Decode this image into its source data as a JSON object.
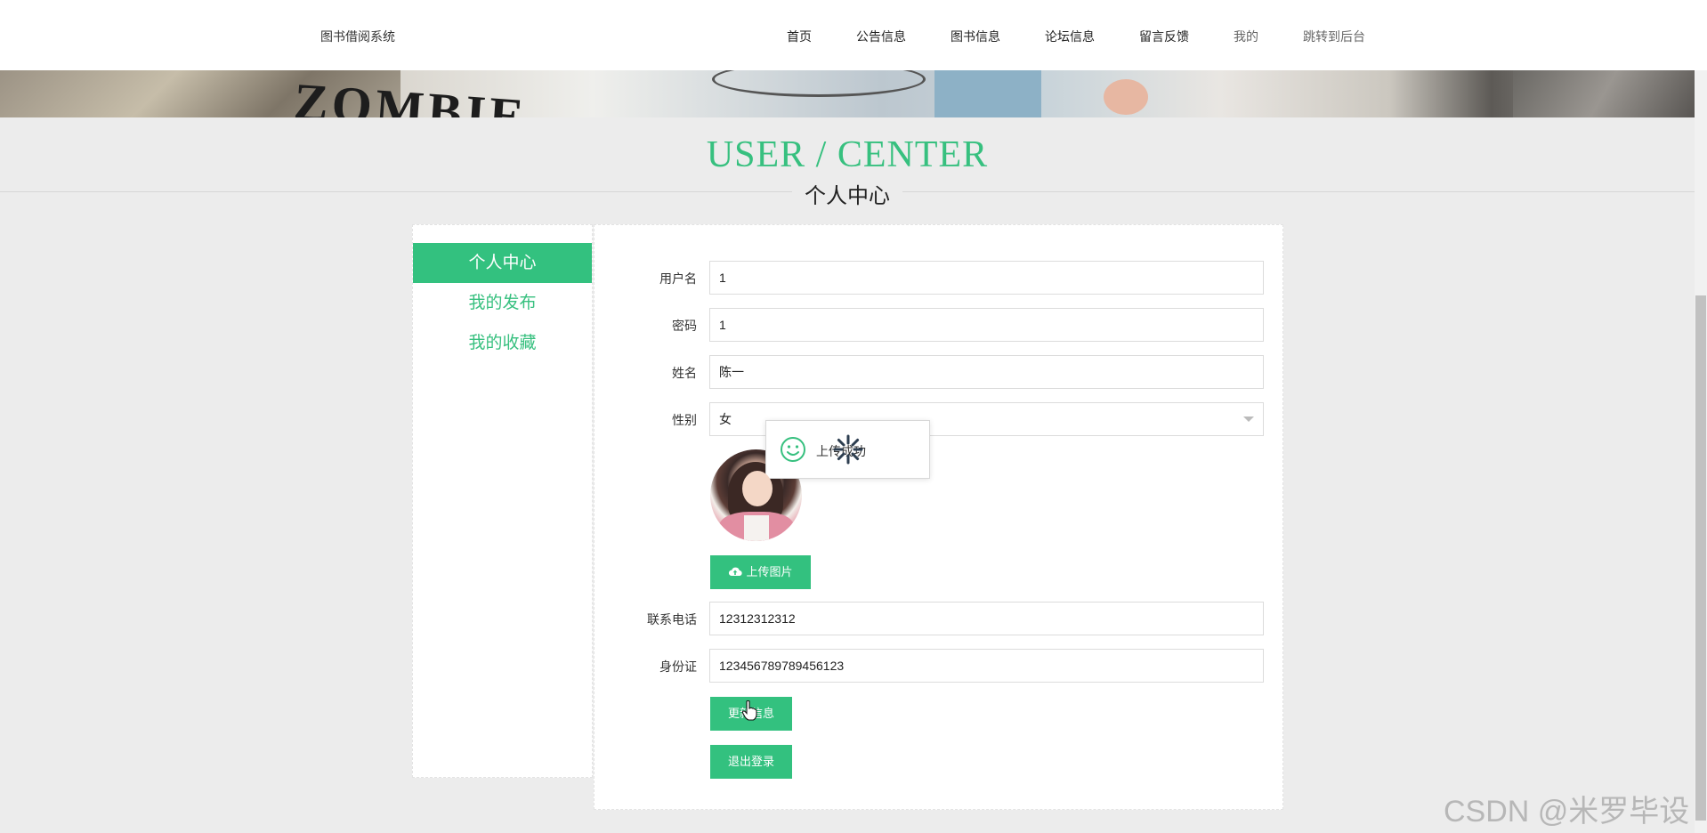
{
  "header": {
    "brand": "图书借阅系统",
    "nav": [
      "首页",
      "公告信息",
      "图书信息",
      "论坛信息",
      "留言反馈",
      "我的",
      "跳转到后台"
    ]
  },
  "section": {
    "title_en": "USER / CENTER",
    "title_cn": "个人中心"
  },
  "sidebar": {
    "items": [
      "个人中心",
      "我的发布",
      "我的收藏"
    ]
  },
  "form": {
    "username": {
      "label": "用户名",
      "value": "1"
    },
    "password": {
      "label": "密码",
      "value": "1"
    },
    "name": {
      "label": "姓名",
      "value": "陈一"
    },
    "gender": {
      "label": "性别",
      "value": "女"
    },
    "phone": {
      "label": "联系电话",
      "value": "12312312312"
    },
    "idcard": {
      "label": "身份证",
      "value": "123456789789456123"
    },
    "upload_label": "上传图片",
    "update_label": "更新信息",
    "logout_label": "退出登录"
  },
  "toast": {
    "text": "上传成功"
  },
  "watermark": "CSDN @米罗毕设",
  "colors": {
    "accent": "#33c17f",
    "title": "#37c07f"
  }
}
